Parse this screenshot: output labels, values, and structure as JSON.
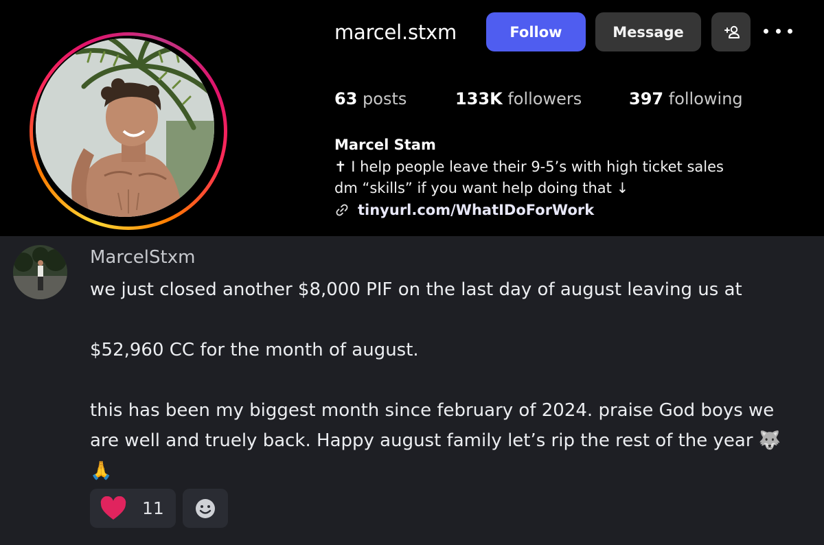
{
  "profile": {
    "username": "marcel.stxm",
    "follow_label": "Follow",
    "message_label": "Message",
    "stats": {
      "posts_count": "63",
      "posts_label": "posts",
      "followers_count": "133K",
      "followers_label": "followers",
      "following_count": "397",
      "following_label": "following"
    },
    "full_name": "Marcel Stam",
    "bio_line1": "✝ I help people leave their 9-5’s with high ticket sales",
    "bio_line2": "dm “skills” if you want help doing that ↓",
    "link": "tinyurl.com/WhatIDoForWork",
    "ring_colors": [
      "#fdd835",
      "#ff7a00",
      "#ff2d55",
      "#c13584"
    ],
    "follow_color": "#4f5df0",
    "icons": [
      "add-user-icon",
      "more-icon",
      "link-icon"
    ]
  },
  "message": {
    "author": "MarcelStxm",
    "lines": [
      "we just closed another $8,000 PIF on the last day of august leaving us at",
      "",
      "$52,960 CC for the month of august.",
      "",
      "this has been my biggest month since february of 2024. praise God boys we",
      "are well and truely back. Happy august family let’s rip the rest of the year"
    ],
    "wolf_emoji": "🐺",
    "pray_emoji": "🙏",
    "reaction": {
      "icon": "heart-icon",
      "count": "11",
      "color": "#e0245e"
    },
    "add_reaction_icon": "smiley-icon",
    "background": "#1e1f24"
  }
}
